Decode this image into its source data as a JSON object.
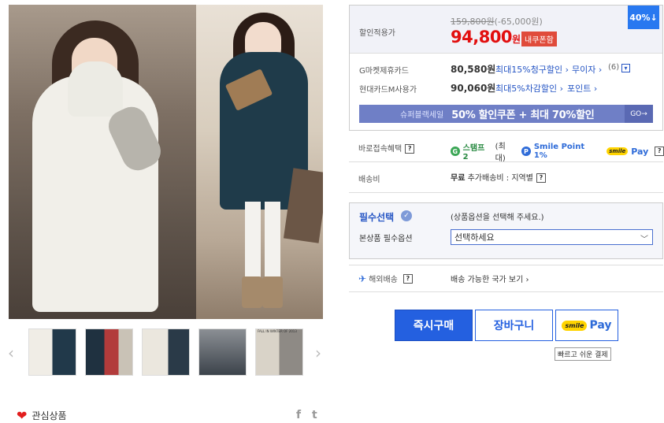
{
  "price": {
    "label": "할인적용가",
    "original": "159,800원",
    "discount_amount": "(-65,000원)",
    "final": "94,800",
    "currency": "원",
    "coupon_badge": "내쿠폰함",
    "discount_badge": "40%↓"
  },
  "cards": [
    {
      "label": "G마켓제휴카드",
      "price": "80,580원",
      "detail": "최대15%청구할인",
      "extra": "무이자",
      "extra_count": "(6)"
    },
    {
      "label": "현대카드M사용가",
      "price": "90,060원",
      "detail": "최대5%차감할인",
      "extra": "포인트"
    }
  ],
  "super_sale": {
    "title": "슈퍼블랙세일",
    "text": "50% 할인쿠폰 + 최대 70%할인",
    "go": "GO→"
  },
  "benefit": {
    "label": "바로접속혜택",
    "g": "G",
    "stamp": "스탬프 2",
    "stamp_note": "(최대)",
    "p": "P",
    "smile_point": "Smile Point 1%",
    "smile": "smile",
    "pay": "Pay"
  },
  "shipping": {
    "label": "배송비",
    "value": "무료",
    "note": "추가배송비 : 지역별"
  },
  "options": {
    "required": "필수선택",
    "hint": "(상품옵션을 선택해 주세요.)",
    "label": "본상품 필수옵션",
    "selected": "선택하세요"
  },
  "overseas": {
    "label": "해외배송",
    "link": "배송 가능한 국가 보기 ›"
  },
  "buttons": {
    "buy": "즉시구매",
    "cart": "장바구니",
    "smile": "smile",
    "pay": "Pay",
    "tooltip": "빠르고 쉬운 결제"
  },
  "favorite": "관심상품",
  "help": "?",
  "check": "✓",
  "chevron_small": "›",
  "thumb_caption": "FALL IN WINTER OF 2013",
  "colors": {
    "accent": "#2460e0",
    "price_red": "#e20f0f",
    "badge_blue": "#2878f0"
  }
}
